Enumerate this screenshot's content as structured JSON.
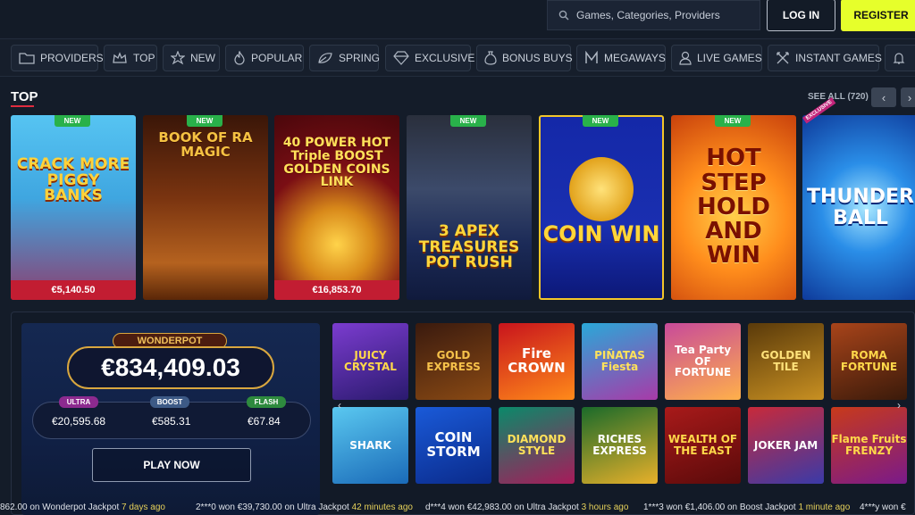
{
  "header": {
    "search_placeholder": "Games, Categories, Providers",
    "login_label": "LOG IN",
    "register_label": "REGISTER",
    "accent": "#e6ff2b"
  },
  "categories": [
    {
      "label": "PROVIDERS",
      "icon": "folder-icon"
    },
    {
      "label": "TOP",
      "icon": "crown-icon"
    },
    {
      "label": "NEW",
      "icon": "star-icon"
    },
    {
      "label": "POPULAR",
      "icon": "flame-icon"
    },
    {
      "label": "SPRING",
      "icon": "leaf-icon"
    },
    {
      "label": "EXCLUSIVE",
      "icon": "diamond-icon"
    },
    {
      "label": "BONUS BUYS",
      "icon": "money-bag-icon"
    },
    {
      "label": "MEGAWAYS",
      "icon": "megaways-icon"
    },
    {
      "label": "LIVE GAMES",
      "icon": "dealer-icon"
    },
    {
      "label": "INSTANT GAMES",
      "icon": "crossed-swords-icon"
    }
  ],
  "top_section": {
    "title": "TOP",
    "see_all": "SEE ALL (720)",
    "tiles": [
      {
        "title": "CRACK MORE PIGGY BANKS",
        "badge": "NEW",
        "jackpot": "€5,140.50"
      },
      {
        "title": "BOOK OF RA MAGIC",
        "badge": "NEW",
        "jackpot": ""
      },
      {
        "title": "40 POWER HOT Triple BOOST GOLDEN COINS LINK",
        "badge": "",
        "jackpot": "€16,853.70"
      },
      {
        "title": "3 APEX TREASURES POT RUSH",
        "badge": "NEW",
        "jackpot": ""
      },
      {
        "title": "COIN WIN",
        "badge": "NEW",
        "jackpot": ""
      },
      {
        "title": "HOT STEP HOLD AND WIN",
        "badge": "NEW",
        "jackpot": ""
      },
      {
        "title": "THUNDER BALL",
        "badge": "EXCLUSIVE",
        "jackpot": ""
      }
    ]
  },
  "wonderpot": {
    "label": "WONDERPOT",
    "amount": "€834,409.03",
    "tiers": [
      {
        "name": "ULTRA",
        "value": "€20,595.68"
      },
      {
        "name": "BOOST",
        "value": "€585.31"
      },
      {
        "name": "FLASH",
        "value": "€67.84"
      }
    ],
    "play_label": "PLAY NOW"
  },
  "grid_games": [
    {
      "title": "JUICY CRYSTAL"
    },
    {
      "title": "GOLD EXPRESS"
    },
    {
      "title": "Fire CROWN"
    },
    {
      "title": "PIÑATAS Fiesta"
    },
    {
      "title": "Tea Party OF FORTUNE"
    },
    {
      "title": "GOLDEN TILE"
    },
    {
      "title": "ROMA FORTUNE"
    },
    {
      "title": "SHARK"
    },
    {
      "title": "COIN STORM"
    },
    {
      "title": "DIAMOND STYLE"
    },
    {
      "title": "RICHES EXPRESS"
    },
    {
      "title": "WEALTH OF THE EAST"
    },
    {
      "title": "JOKER JAM"
    },
    {
      "title": "Flame Fruits FRENZY"
    }
  ],
  "ticker": [
    {
      "text": "862.00 on Wonderpot Jackpot",
      "ago": "7 days ago"
    },
    {
      "text": "2***0 won €39,730.00 on Ultra Jackpot",
      "ago": "42 minutes ago"
    },
    {
      "text": "d***4 won €42,983.00 on Ultra Jackpot",
      "ago": "3 hours ago"
    },
    {
      "text": "1***3 won €1,406.00 on Boost Jackpot",
      "ago": "1 minute ago"
    },
    {
      "text": "4***y won €",
      "ago": ""
    }
  ]
}
